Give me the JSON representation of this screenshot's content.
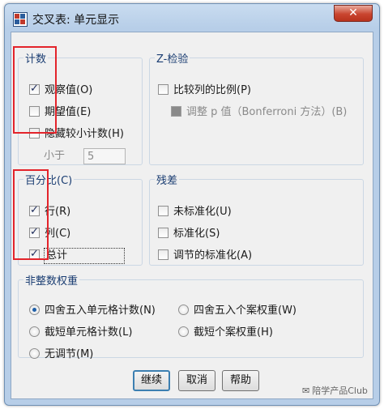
{
  "window": {
    "title": "交叉表: 单元显示",
    "close_glyph": "✕"
  },
  "counts": {
    "legend": "计数",
    "observed": {
      "label": "观察值(O)",
      "checked": true
    },
    "expected": {
      "label": "期望值(E)",
      "checked": false
    },
    "hide_small": {
      "label": "隐藏较小计数(H)",
      "checked": false
    },
    "less_than_label": "小于",
    "less_than_value": "5"
  },
  "z_test": {
    "legend": "Z-检验",
    "compare_columns": {
      "label": "比较列的比例(P)",
      "checked": false
    },
    "adjust_p": {
      "label": "调整 p 值（Bonferroni 方法）(B)",
      "checked": false,
      "enabled": false
    }
  },
  "percentages": {
    "legend": "百分比(C)",
    "row": {
      "label": "行(R)",
      "checked": true
    },
    "column": {
      "label": "列(C)",
      "checked": true
    },
    "total": {
      "label": "总计",
      "checked": true
    }
  },
  "residuals": {
    "legend": "残差",
    "unstandardized": {
      "label": "未标准化(U)",
      "checked": false
    },
    "standardized": {
      "label": "标准化(S)",
      "checked": false
    },
    "adjusted": {
      "label": "调节的标准化(A)",
      "checked": false
    }
  },
  "noninteger_weights": {
    "legend": "非整数权重",
    "options": [
      {
        "label": "四舍五入单元格计数(N)",
        "selected": true
      },
      {
        "label": "四舍五入个案权重(W)",
        "selected": false
      },
      {
        "label": "截短单元格计数(L)",
        "selected": false
      },
      {
        "label": "截短个案权重(H)",
        "selected": false
      },
      {
        "label": "无调节(M)",
        "selected": false
      }
    ]
  },
  "buttons": {
    "continue": "继续",
    "cancel": "取消",
    "help": "帮助"
  },
  "watermark": {
    "text": "陪学产品Club",
    "icon": "wechat-icon"
  },
  "colors": {
    "highlight": "#e3242b",
    "accent": "#1f5fa8"
  }
}
